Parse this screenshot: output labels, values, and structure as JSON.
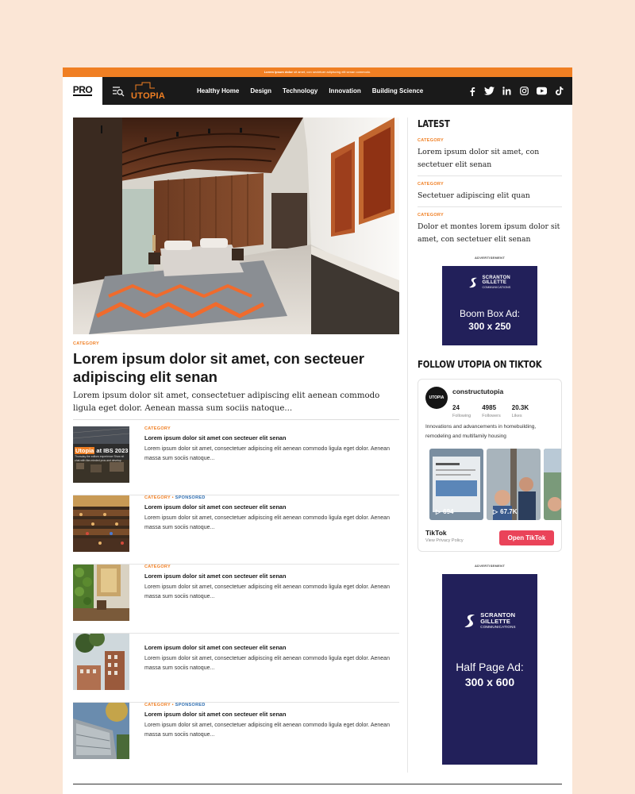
{
  "promo_bar": {
    "bold": "Lorem ipsum dolor",
    "text": " sit amet, con sectetuer adipiscing elit senan commodo."
  },
  "header": {
    "pro_logo": "PRO",
    "site_logo": "UTOPIA",
    "nav": [
      "Healthy Home",
      "Design",
      "Technology",
      "Innovation",
      "Building Science"
    ],
    "socials": [
      "facebook-icon",
      "twitter-icon",
      "linkedin-icon",
      "instagram-icon",
      "youtube-icon",
      "tiktok-icon"
    ]
  },
  "hero": {
    "category": "CATEGORY",
    "title": "Lorem ipsum dolor sit amet, con secteuer adipiscing elit senan",
    "excerpt": "Lorem ipsum dolor sit amet, consectetuer adipiscing elit aenean commodo ligula eget dolor. Aenean massa sum sociis natoque..."
  },
  "articles": [
    {
      "category": "CATEGORY",
      "sponsored": "",
      "title": "Lorem ipsum dolor sit amet con secteuer elit senan",
      "excerpt": "Lorem ipsum dolor sit amet, consectetuer adipiscing elit aenean commodo ligula eget dolor. Aenean massa sum sociis natoque...",
      "thumb_caption_accent": "Utopia",
      "thumb_caption": " at IBS 2023",
      "thumb_subcaption": "Thursday the editors experience Show sit chat with like-minded pros and develop"
    },
    {
      "category": "CATEGORY",
      "sponsored": "SPONSORED",
      "title": "Lorem ipsum dolor sit amet con secteuer elit senan",
      "excerpt": "Lorem ipsum dolor sit amet, consectetuer adipiscing elit aenean commodo ligula eget dolor. Aenean massa sum sociis natoque..."
    },
    {
      "category": "CATEGORY",
      "sponsored": "",
      "title": "Lorem ipsum dolor sit amet con secteuer elit senan",
      "excerpt": "Lorem ipsum dolor sit amet, consectetuer adipiscing elit aenean commodo ligula eget dolor. Aenean massa sum sociis natoque..."
    },
    {
      "category": "",
      "sponsored": "",
      "title": "Lorem ipsum dolor sit amet con secteuer elit senan",
      "excerpt": "Lorem ipsum dolor sit amet, consectetuer adipiscing elit aenean commodo ligula eget dolor. Aenean massa sum sociis natoque..."
    },
    {
      "category": "CATEGORY",
      "sponsored": "SPONSORED",
      "title": "Lorem ipsum dolor sit amet con secteuer elit senan",
      "excerpt": "Lorem ipsum dolor sit amet, consectetuer adipiscing elit aenean commodo ligula eget dolor. Aenean massa sum sociis natoque..."
    }
  ],
  "sidebar": {
    "latest_heading": "LATEST",
    "latest": [
      {
        "category": "CATEGORY",
        "title": "Lorem ipsum dolor sit amet, con sectetuer elit senan"
      },
      {
        "category": "CATEGORY",
        "title": "Sectetuer adipiscing elit quan"
      },
      {
        "category": "CATEGORY",
        "title": "Dolor et montes lorem ipsum dolor sit amet, con sectetuer elit senan"
      }
    ],
    "ad_label": "ADVERTISEMENT",
    "ad1": {
      "logo_line1": "SCRANTON",
      "logo_line2": "GILLETTE",
      "logo_line3": "COMMUNICATIONS",
      "line1": "Boom Box Ad:",
      "line2": "300 x 250"
    },
    "tiktok_heading": "FOLLOW UTOPIA ON TIKTOK",
    "tiktok": {
      "avatar_text": "UTOPIA",
      "username": "constructutopia",
      "stats": [
        {
          "value": "24",
          "label": "Following"
        },
        {
          "value": "4985",
          "label": "Followers"
        },
        {
          "value": "20.3K",
          "label": "Likes"
        }
      ],
      "bio": "Innovations and advancements in homebuilding, remodeling and multifamily housing",
      "videos": [
        {
          "views": "694"
        },
        {
          "views": "67.7K"
        },
        {
          "views": ""
        }
      ],
      "brand": "TikTok",
      "privacy": "View Privacy Policy",
      "open_button": "Open TikTok"
    },
    "ad2": {
      "logo_line1": "SCRANTON",
      "logo_line2": "GILLETTE",
      "logo_line3": "COMMUNICATIONS",
      "line1": "Half Page Ad:",
      "line2": "300 x 600"
    }
  },
  "colors": {
    "accent": "#f07f23",
    "nav_bg": "#1a1a1a",
    "ad_bg": "#22205a",
    "tiktok_button": "#ea4359",
    "sponsored": "#2b6cb0"
  }
}
